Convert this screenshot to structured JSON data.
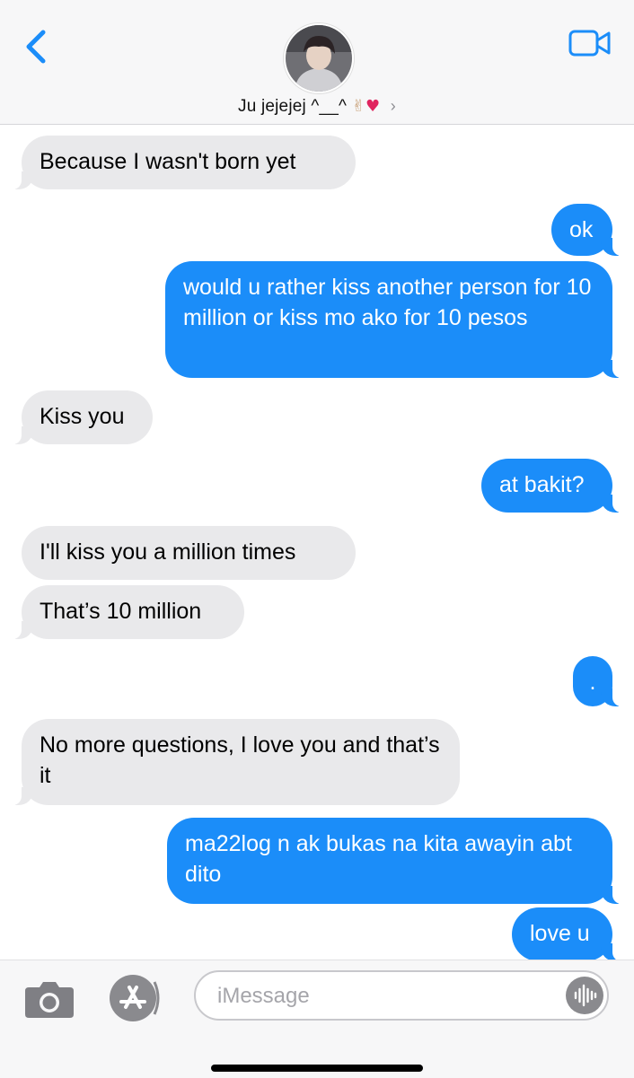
{
  "header": {
    "contact_name": "Ju jejejej ^__^",
    "emoji_hand": "✌",
    "emoji_heart": "♥",
    "chevron": "›",
    "back_icon": "chevron-left-icon",
    "video_icon": "video-camera-icon",
    "accent": "#1b8df9"
  },
  "messages": [
    {
      "sender": "them",
      "text": "Because I wasn't born yet"
    },
    {
      "sender": "me",
      "text": "ok"
    },
    {
      "sender": "me",
      "text": "would u rather kiss another person for 10 million or kiss mo ako for 10 pesos"
    },
    {
      "sender": "them",
      "text": "Kiss you"
    },
    {
      "sender": "me",
      "text": "at bakit?"
    },
    {
      "sender": "them",
      "text": "I'll kiss you a million times"
    },
    {
      "sender": "them",
      "text": "That’s 10 million"
    },
    {
      "sender": "me",
      "text": "."
    },
    {
      "sender": "them",
      "text": "No more questions, I love you and that’s it"
    },
    {
      "sender": "me",
      "text": "ma22log n ak bukas na kita awayin abt dito"
    },
    {
      "sender": "me",
      "text": "love u"
    }
  ],
  "input": {
    "placeholder": "iMessage",
    "value": "",
    "camera_icon": "camera-icon",
    "apps_icon": "app-store-icon",
    "audio_icon": "audio-waveform-icon"
  },
  "colors": {
    "incoming_bubble": "#e9e9eb",
    "outgoing_bubble": "#1b8df9"
  }
}
